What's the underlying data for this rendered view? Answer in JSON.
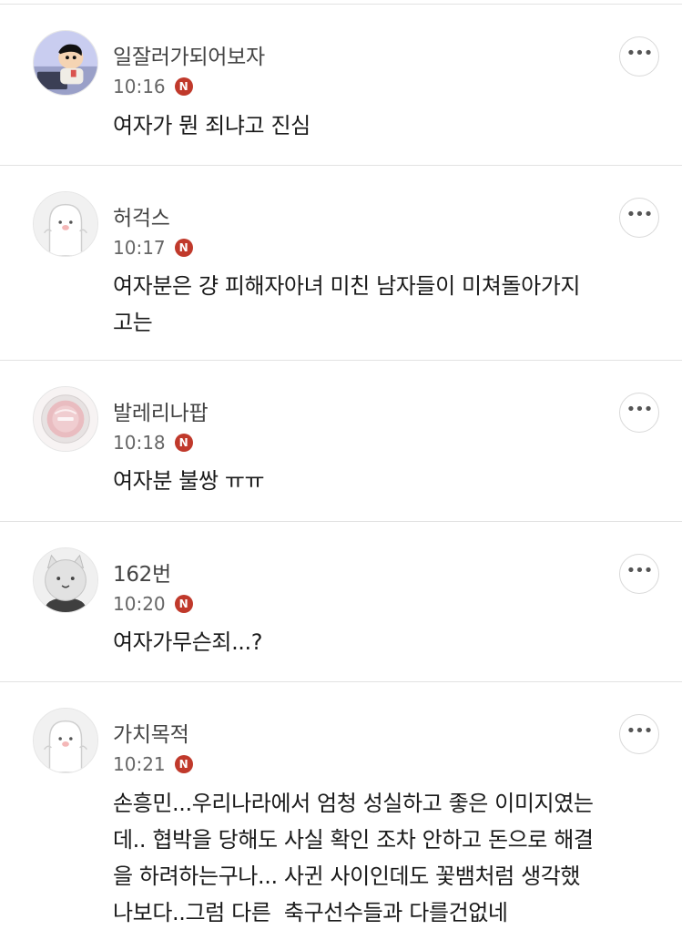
{
  "more_glyph": "•••",
  "new_badge": "N",
  "comments": [
    {
      "nickname": "일잘러가되어보자",
      "time": "10:16",
      "avatar": "cartoon-boy",
      "text": "여자가 뭔 죄냐고 진심"
    },
    {
      "nickname": "허걱스",
      "time": "10:17",
      "avatar": "white-character",
      "text": "여자분은 걍 피해자아녀 미친 남자들이 미쳐돌아가지\n고는"
    },
    {
      "nickname": "발레리나팝",
      "time": "10:18",
      "avatar": "pink-compact",
      "text": "여자분 불쌍 ㅠㅠ"
    },
    {
      "nickname": "162번",
      "time": "10:20",
      "avatar": "gray-character",
      "text": "여자가무슨죄...?"
    },
    {
      "nickname": "가치목적",
      "time": "10:21",
      "avatar": "white-character",
      "text": "손흥민...우리나라에서 엄청 성실하고 좋은 이미지였는\n데.. 협박을 당해도 사실 확인 조차 안하고 돈으로 해결\n을 하려하는구나... 사귄 사이인데도 꽃뱀처럼 생각했\n나보다..그럼 다른  축구선수들과 다를건없네"
    }
  ]
}
